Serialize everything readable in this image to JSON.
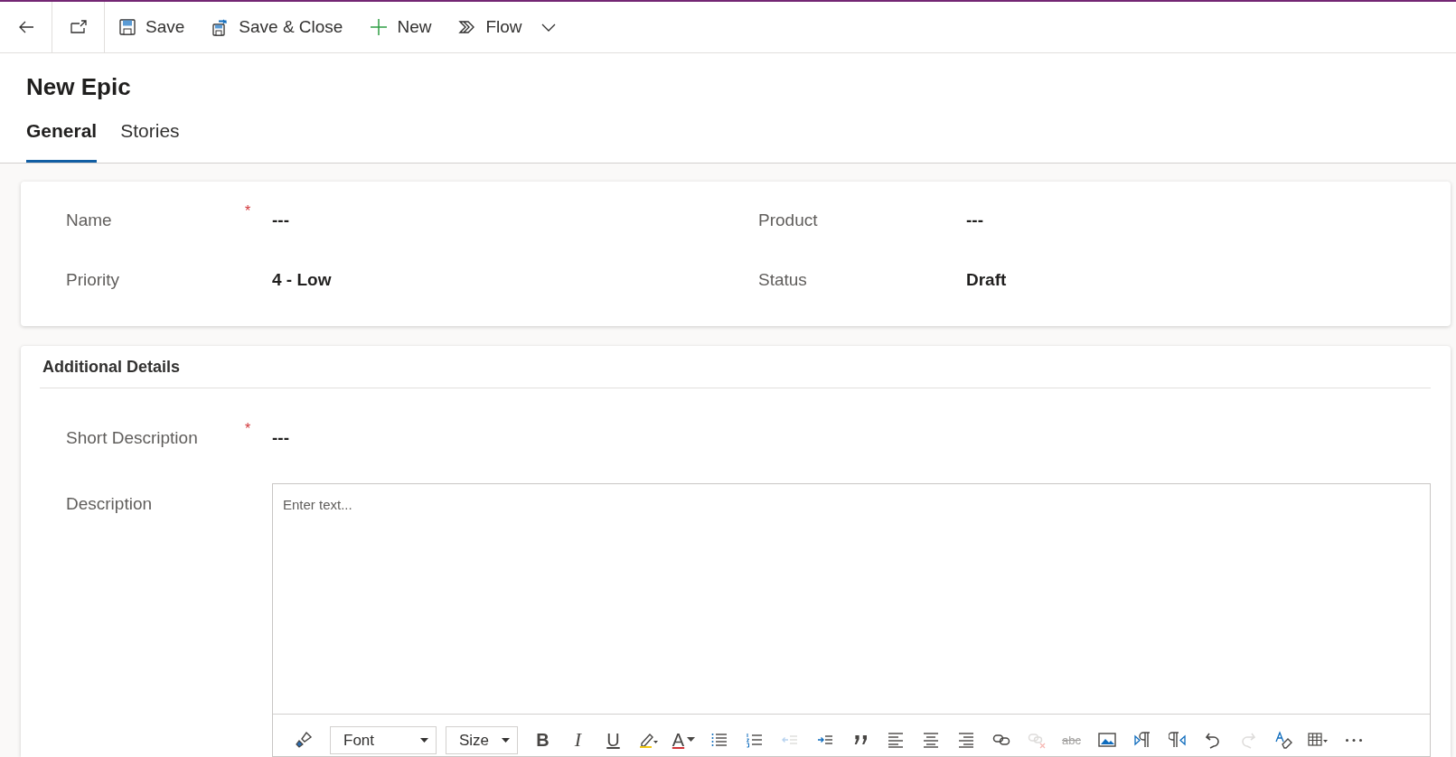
{
  "command_bar": {
    "buttons": [
      {
        "kind": "back"
      },
      {
        "kind": "popout"
      },
      {
        "kind": "save",
        "label": "Save"
      },
      {
        "kind": "save-close",
        "label": "Save & Close"
      },
      {
        "kind": "new",
        "label": "New"
      },
      {
        "kind": "flow",
        "label": "Flow"
      },
      {
        "kind": "chevron"
      }
    ]
  },
  "title": "New Epic",
  "tabs": [
    {
      "label": "General",
      "selected": true
    },
    {
      "label": "Stories",
      "selected": false
    }
  ],
  "general_card": {
    "fields": [
      {
        "label": "Name",
        "required_mark": "*",
        "value": "---"
      },
      {
        "label": "Product",
        "value": "---"
      },
      {
        "label": "Priority",
        "value": "4 - Low"
      },
      {
        "label": "Status",
        "value": "Draft"
      }
    ]
  },
  "details_card": {
    "title": "Additional Details",
    "short_description": {
      "label": "Short Description",
      "required_mark": "*",
      "value": "---"
    },
    "description": {
      "label": "Description",
      "placeholder": "Enter text...",
      "toolbar": [
        {
          "kind": "brush",
          "disabled": false
        },
        {
          "kind": "dropdown",
          "label": "Font",
          "disabled": false
        },
        {
          "kind": "dropdown",
          "label": "Size",
          "disabled": false
        },
        {
          "kind": "bold",
          "label": "B",
          "disabled": false
        },
        {
          "kind": "italic",
          "label": "I",
          "disabled": false
        },
        {
          "kind": "underline",
          "label": "U",
          "disabled": false
        },
        {
          "kind": "highlight",
          "disabled": false
        },
        {
          "kind": "fontcolor",
          "label": "A",
          "disabled": false
        },
        {
          "kind": "bullets",
          "disabled": false
        },
        {
          "kind": "numbering",
          "disabled": false
        },
        {
          "kind": "outdent",
          "disabled": true
        },
        {
          "kind": "indent",
          "disabled": false
        },
        {
          "kind": "quote",
          "disabled": false
        },
        {
          "kind": "align-left",
          "disabled": false
        },
        {
          "kind": "align-center",
          "disabled": false
        },
        {
          "kind": "align-right",
          "disabled": false
        },
        {
          "kind": "link",
          "disabled": false
        },
        {
          "kind": "unlink",
          "disabled": true
        },
        {
          "kind": "strike",
          "label": "abc",
          "disabled": true
        },
        {
          "kind": "image",
          "disabled": false
        },
        {
          "kind": "ltr",
          "disabled": false
        },
        {
          "kind": "rtl",
          "disabled": false
        },
        {
          "kind": "undo",
          "disabled": false
        },
        {
          "kind": "redo",
          "disabled": true
        },
        {
          "kind": "clear-format",
          "disabled": false
        },
        {
          "kind": "table",
          "disabled": false
        },
        {
          "kind": "more",
          "disabled": false
        }
      ]
    }
  }
}
